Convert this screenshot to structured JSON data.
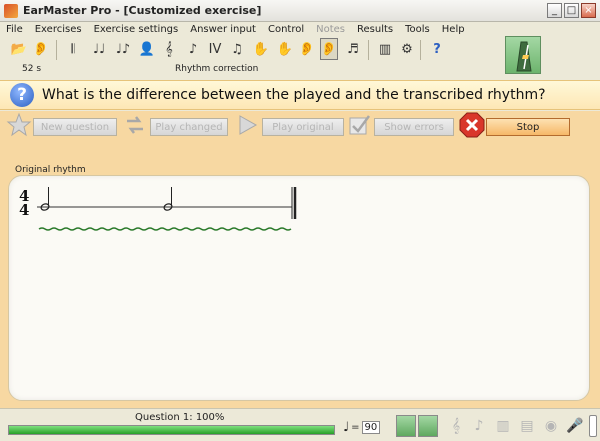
{
  "window": {
    "title": "EarMaster Pro - [Customized exercise]",
    "buttons": [
      "_",
      "□",
      "×"
    ]
  },
  "menu": {
    "items": [
      "File",
      "Exercises",
      "Exercise settings",
      "Answer input",
      "Control",
      "Notes",
      "Results",
      "Tools",
      "Help"
    ],
    "disabled": [
      "Notes"
    ]
  },
  "toolbar": {
    "timer": "52 s",
    "mode_caption": "Rhythm correction",
    "buttons": [
      {
        "icon": "open-folder-icon",
        "glyph": "📂"
      },
      {
        "icon": "ear-icon",
        "glyph": "👂"
      },
      {
        "icon": "interval-comparison-icon",
        "glyph": "𝄃"
      },
      {
        "icon": "interval-identification-icon",
        "glyph": "♩♩"
      },
      {
        "icon": "interval-singing-icon",
        "glyph": "♩♪"
      },
      {
        "icon": "chord-singing-icon",
        "glyph": "👤"
      },
      {
        "icon": "chord-identification-icon",
        "glyph": "𝄞"
      },
      {
        "icon": "chord-inversion-icon",
        "glyph": "♪"
      },
      {
        "icon": "chord-progression-icon",
        "glyph": "IV"
      },
      {
        "icon": "scale-identification-icon",
        "glyph": "♫"
      },
      {
        "icon": "rhythm-imitation-icon",
        "glyph": "✋"
      },
      {
        "icon": "rhythm-reading-icon",
        "glyph": "✋"
      },
      {
        "icon": "rhythm-dictation-icon",
        "glyph": "👂"
      },
      {
        "icon": "rhythm-correction-icon",
        "glyph": "👂"
      },
      {
        "icon": "melody-icon",
        "glyph": "♬"
      },
      {
        "icon": "results-icon",
        "glyph": "▥"
      },
      {
        "icon": "settings-icon",
        "glyph": "⚙"
      },
      {
        "icon": "help-icon",
        "glyph": "?"
      }
    ]
  },
  "question": {
    "text": "What is the difference between the played and the transcribed rhythm?"
  },
  "actions": {
    "new_question": "New question",
    "play_changed": "Play changed",
    "play_original": "Play original",
    "show_errors": "Show errors",
    "stop": "Stop"
  },
  "score": {
    "section_label": "Original rhythm",
    "time_signature": {
      "top": "4",
      "bottom": "4"
    }
  },
  "status": {
    "text": "Question 1: 100%",
    "progress": 1.0,
    "tempo_label": "=",
    "tempo_value": "90"
  },
  "colors": {
    "question_band": "#fde7b5",
    "action_area": "#f7d8a2",
    "progress": "#28a028",
    "stop_button": "#f6b868"
  }
}
